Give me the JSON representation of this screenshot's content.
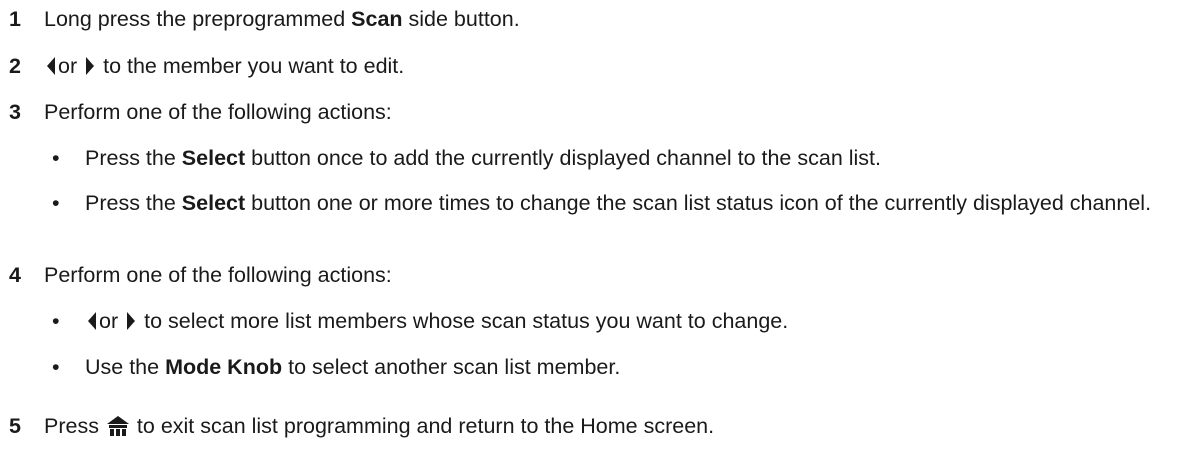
{
  "steps": [
    {
      "num": "1",
      "pre": "Long press the preprogrammed ",
      "bold": "Scan",
      "post": " side button."
    },
    {
      "num": "2",
      "or": "or",
      "post": "to the member you want to edit."
    },
    {
      "num": "3",
      "text": "Perform one of the following actions:"
    },
    {
      "num": "4",
      "text": "Perform one of the following actions:"
    },
    {
      "num": "5",
      "pre": "Press ",
      "post": " to exit scan list programming and return to the Home screen."
    }
  ],
  "step3_bullets": [
    {
      "dot": "•",
      "pre": "Press the ",
      "bold": "Select",
      "post": " button once to add the currently displayed channel to the scan list."
    },
    {
      "dot": "•",
      "pre": "Press the ",
      "bold": "Select",
      "post": " button one or more times to change the scan list status icon of the currently displayed channel."
    }
  ],
  "step4_bullets": [
    {
      "dot": "•",
      "or": "or",
      "post": "to select more list members whose scan status you want to change."
    },
    {
      "dot": "•",
      "pre": "Use the ",
      "bold": "Mode Knob",
      "post": " to select another scan list member."
    }
  ],
  "icons": {
    "left": "left-arrow-icon",
    "right": "right-arrow-icon",
    "home": "home-icon"
  }
}
